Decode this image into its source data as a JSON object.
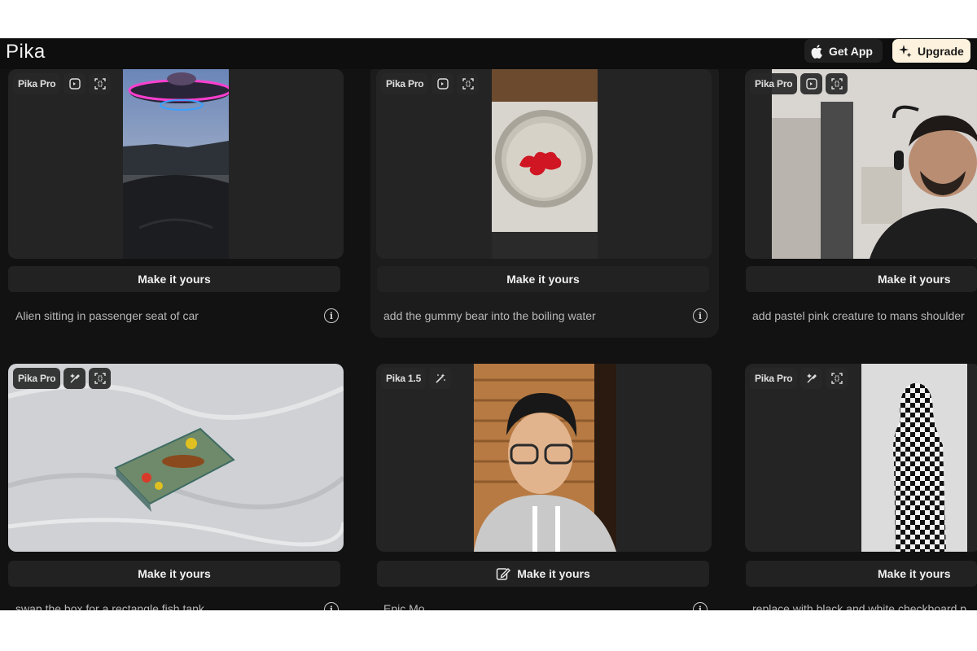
{
  "app": {
    "logo": "Pika"
  },
  "header": {
    "get_app_label": "Get App",
    "upgrade_label": "Upgrade"
  },
  "cards": [
    {
      "badge": "Pika Pro",
      "button_label": "Make it yours",
      "prompt": "Alien sitting in passenger seat of car",
      "icons": [
        "sound-effect-icon",
        "expand-frame-icon"
      ]
    },
    {
      "badge": "Pika Pro",
      "button_label": "Make it yours",
      "prompt": "add the gummy bear into the boiling water",
      "icons": [
        "sound-effect-icon",
        "expand-frame-icon"
      ]
    },
    {
      "badge": "Pika Pro",
      "button_label": "Make it yours",
      "prompt": "add pastel pink creature to mans shoulder",
      "icons": [
        "sound-effect-icon",
        "expand-frame-icon"
      ]
    },
    {
      "badge": "Pika Pro",
      "button_label": "Make it yours",
      "prompt": "swap the box for a rectangle fish tank",
      "icons": [
        "pikaswap-icon",
        "expand-frame-icon"
      ]
    },
    {
      "badge": "Pika 1.5",
      "button_label": "Make it yours",
      "prompt": "Epic Mo",
      "icons": [
        "magic-wand-icon"
      ]
    },
    {
      "badge": "Pika Pro",
      "button_label": "Make it yours",
      "prompt": "replace with black and white checkboard p",
      "icons": [
        "pikaswap-icon",
        "expand-frame-icon"
      ]
    }
  ],
  "colors": {
    "background": "#121212",
    "card": "#1c1c1c",
    "upgrade_bg": "#fcf2de",
    "accent_ufo": "#ff3fd0"
  }
}
